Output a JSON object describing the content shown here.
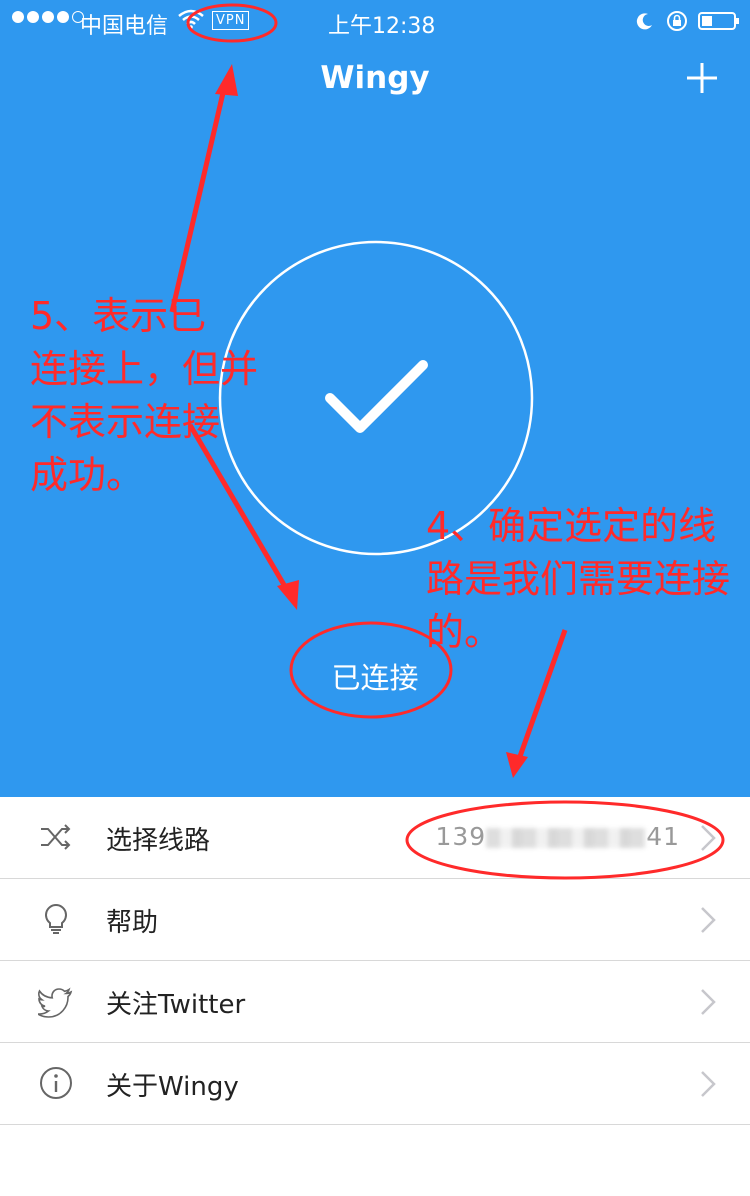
{
  "status_bar": {
    "carrier": "中国电信",
    "vpn": "VPN",
    "time": "上午12:38"
  },
  "header": {
    "title": "Wingy"
  },
  "connection": {
    "status": "已连接"
  },
  "menu": [
    {
      "label": "选择线路",
      "value_prefix": "139",
      "value_suffix": "41"
    },
    {
      "label": "帮助"
    },
    {
      "label": "关注Twitter"
    },
    {
      "label": "关于Wingy"
    }
  ],
  "annotations": {
    "note5": [
      "5、表示已",
      "连接上，但并",
      "不表示连接",
      "成功。"
    ],
    "note4": [
      "4、确定选定的线",
      "路是我们需要连接",
      "的。"
    ]
  },
  "colors": {
    "accent": "#2f98ef",
    "annotation": "#ff2a2a"
  }
}
